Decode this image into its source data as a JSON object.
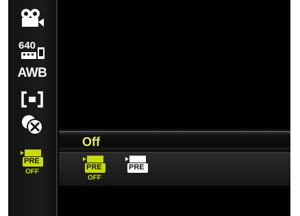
{
  "sidebar": {
    "items": [
      {
        "icon": "movie-camera-icon"
      },
      {
        "icon": "resolution-640-icon",
        "label": "640"
      },
      {
        "label": "AWB",
        "icon": "white-balance-text"
      },
      {
        "icon": "metering-spot-icon"
      },
      {
        "icon": "color-effect-off-icon"
      },
      {
        "icon": "pre-record-off-icon",
        "label": "PRE",
        "sub": "OFF"
      }
    ]
  },
  "option_menu": {
    "title": "Off",
    "options": [
      {
        "icon": "pre-record-off-icon",
        "label": "PRE",
        "sub": "OFF",
        "selected": true
      },
      {
        "icon": "pre-record-on-icon",
        "label": "PRE",
        "selected": false
      }
    ]
  },
  "colors": {
    "accent": "#c8dc00",
    "title": "#e6f05a",
    "background": "#000000"
  }
}
